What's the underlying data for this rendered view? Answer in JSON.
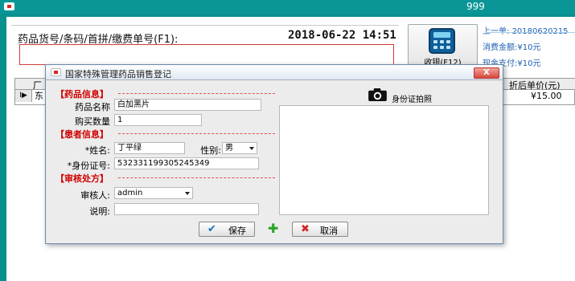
{
  "window": {
    "title": "999"
  },
  "main": {
    "code_label": "药品货号/条码/首拼/缴费单号(F1):",
    "datetime": "2018-06-22 14:51",
    "code_value": "",
    "checkout_label": "收银(F12)"
  },
  "info": {
    "last_order_label": "上一单:",
    "last_order_value": "20180620215",
    "amount_label": "消费金额:",
    "amount_value": "¥10元",
    "cash_label": "现金支付:",
    "cash_value": "¥10元"
  },
  "grid": {
    "headers": [
      "厂",
      "折后单价(元)"
    ],
    "rows": [
      {
        "indicator": "I▶",
        "c1": "东",
        "price": "¥15.00"
      }
    ]
  },
  "dialog": {
    "title": "国家特殊管理药品销售登记",
    "close_glyph": "X",
    "sections": {
      "drug_info": "【药品信息】",
      "patient_info": "【患者信息】",
      "review": "【审核处方】"
    },
    "fields": {
      "drug_name_label": "药品名称",
      "drug_name_value": "白加黑片",
      "qty_label": "购买数量",
      "qty_value": "1",
      "name_label": "*姓名:",
      "name_value": "丁平绿",
      "gender_label": "性别:",
      "gender_value": "男",
      "id_label": "*身份证号:",
      "id_value": "532331199305245349",
      "reviewer_label": "审核人:",
      "reviewer_value": "admin",
      "note_label": "说明:",
      "note_value": ""
    },
    "photo_label": "身份证拍照",
    "buttons": {
      "save": "保存",
      "cancel": "取消"
    }
  }
}
